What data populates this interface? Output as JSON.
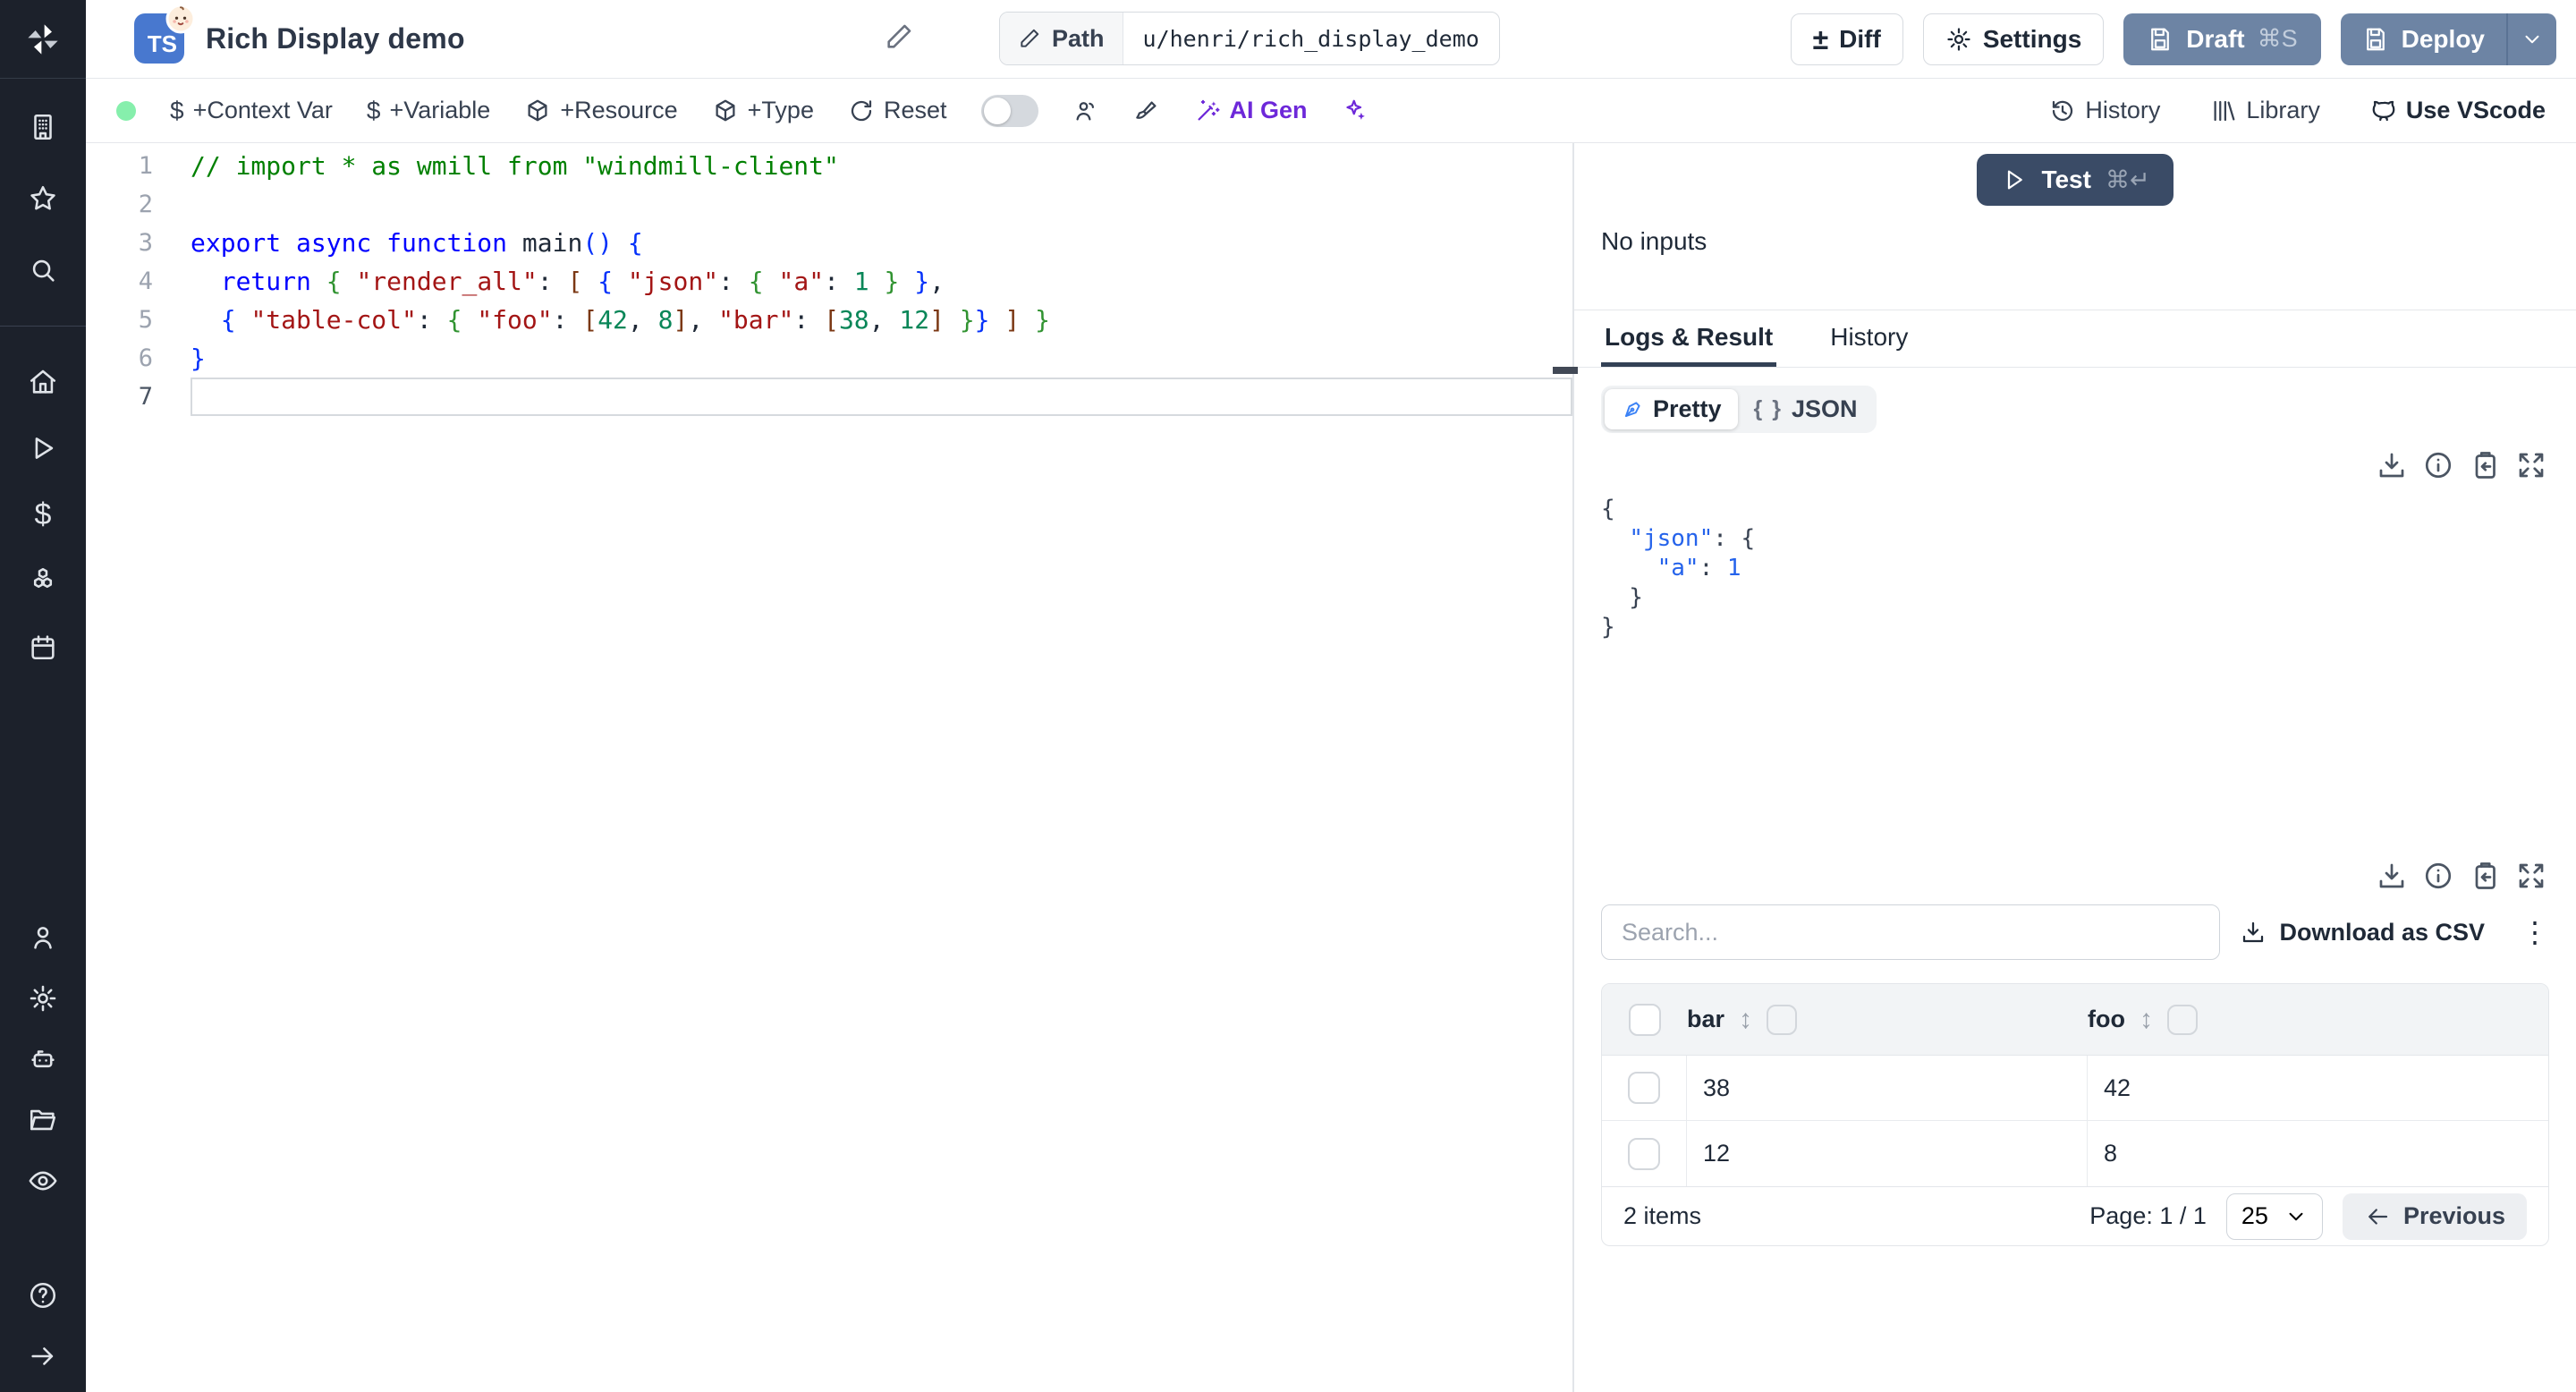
{
  "colors": {
    "accent_slate_button": "#6d84a4",
    "test_button_navy": "#3a4b66",
    "ai_purple": "#6d28d9",
    "ready_dot_green": "#86efac",
    "ts_badge_blue": "#4878cf",
    "active_tab_underline": "#334155",
    "sidebar_dark": "#1c212b"
  },
  "header": {
    "title": "Rich Display demo",
    "ts_label": "TS",
    "path_label": "Path",
    "path_value": "u/henri/rich_display_demo",
    "diff_label": "Diff",
    "settings_label": "Settings",
    "draft_label": "Draft",
    "draft_shortcut": "⌘S",
    "deploy_label": "Deploy"
  },
  "toolbar": {
    "context_var": "+Context Var",
    "variable": "+Variable",
    "resource": "+Resource",
    "type": "+Type",
    "reset": "Reset",
    "ai_gen": "AI Gen",
    "history": "History",
    "library": "Library",
    "vscode": "Use VScode"
  },
  "editor": {
    "lines": [
      {
        "num": "1",
        "tokens": [
          [
            "c",
            "// import * as wmill from \"windmill-client\""
          ]
        ]
      },
      {
        "num": "2",
        "tokens": []
      },
      {
        "num": "3",
        "tokens": [
          [
            "k",
            "export async function "
          ],
          [
            "d",
            "main"
          ],
          [
            "b1",
            "()"
          ],
          [
            "d",
            " "
          ],
          [
            "b1",
            "{"
          ]
        ]
      },
      {
        "num": "4",
        "tokens": [
          [
            "d",
            "  "
          ],
          [
            "k",
            "return"
          ],
          [
            "d",
            " "
          ],
          [
            "b2",
            "{"
          ],
          [
            "d",
            " "
          ],
          [
            "s",
            "\"render_all\""
          ],
          [
            "d",
            ": "
          ],
          [
            "b3",
            "["
          ],
          [
            "d",
            " "
          ],
          [
            "b1",
            "{"
          ],
          [
            "d",
            " "
          ],
          [
            "s",
            "\"json\""
          ],
          [
            "d",
            ": "
          ],
          [
            "b2",
            "{"
          ],
          [
            "d",
            " "
          ],
          [
            "s",
            "\"a\""
          ],
          [
            "d",
            ": "
          ],
          [
            "n",
            "1"
          ],
          [
            "d",
            " "
          ],
          [
            "b2",
            "}"
          ],
          [
            "d",
            " "
          ],
          [
            "b1",
            "}"
          ],
          [
            "d",
            ","
          ]
        ]
      },
      {
        "num": "5",
        "tokens": [
          [
            "d",
            "  "
          ],
          [
            "b1",
            "{"
          ],
          [
            "d",
            " "
          ],
          [
            "s",
            "\"table-col\""
          ],
          [
            "d",
            ": "
          ],
          [
            "b2",
            "{"
          ],
          [
            "d",
            " "
          ],
          [
            "s",
            "\"foo\""
          ],
          [
            "d",
            ": "
          ],
          [
            "b3",
            "["
          ],
          [
            "n",
            "42"
          ],
          [
            "d",
            ", "
          ],
          [
            "n",
            "8"
          ],
          [
            "b3",
            "]"
          ],
          [
            "d",
            ", "
          ],
          [
            "s",
            "\"bar\""
          ],
          [
            "d",
            ": "
          ],
          [
            "b3",
            "["
          ],
          [
            "n",
            "38"
          ],
          [
            "d",
            ", "
          ],
          [
            "n",
            "12"
          ],
          [
            "b3",
            "]"
          ],
          [
            "d",
            " "
          ],
          [
            "b2",
            "}"
          ],
          [
            "b1",
            "}"
          ],
          [
            "d",
            " "
          ],
          [
            "b3",
            "]"
          ],
          [
            "d",
            " "
          ],
          [
            "b2",
            "}"
          ]
        ]
      },
      {
        "num": "6",
        "tokens": [
          [
            "b1",
            "}"
          ]
        ]
      },
      {
        "num": "7",
        "tokens": [],
        "current": true
      }
    ]
  },
  "right": {
    "test_label": "Test",
    "test_shortcut": "⌘↵",
    "no_inputs": "No inputs",
    "tabs": [
      "Logs & Result",
      "History"
    ],
    "pretty_label": "Pretty",
    "json_label": "JSON",
    "result_lines": [
      [
        [
          "rp",
          "{"
        ]
      ],
      [
        [
          "rp",
          "  "
        ],
        [
          "rk",
          "\"json\""
        ],
        [
          "rp",
          ": {"
        ]
      ],
      [
        [
          "rp",
          "    "
        ],
        [
          "rk",
          "\"a\""
        ],
        [
          "rp",
          ": "
        ],
        [
          "rv",
          "1"
        ]
      ],
      [
        [
          "rp",
          "  }"
        ]
      ],
      [
        [
          "rp",
          "}"
        ]
      ]
    ],
    "search_placeholder": "Search...",
    "download_csv": "Download as CSV",
    "table": {
      "columns": [
        "bar",
        "foo"
      ],
      "rows": [
        [
          "38",
          "42"
        ],
        [
          "12",
          "8"
        ]
      ]
    },
    "footer": {
      "items_count": "2 items",
      "page": "Page: 1 / 1",
      "page_size": "25",
      "previous": "Previous"
    }
  }
}
